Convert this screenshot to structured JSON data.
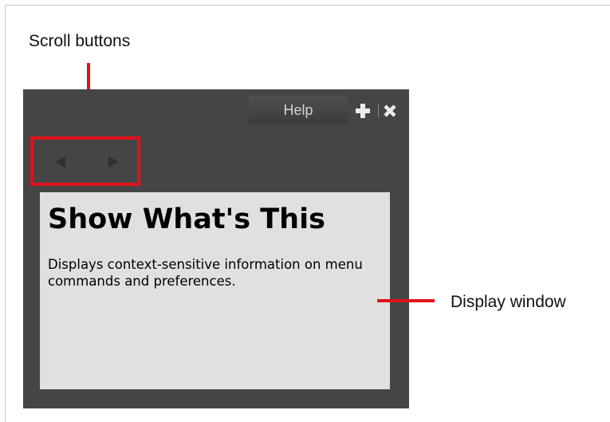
{
  "annotations": {
    "scroll_buttons_label": "Scroll buttons",
    "display_window_label": "Display window",
    "callout_color": "#e0121b"
  },
  "panel": {
    "tab": {
      "label": "Help"
    },
    "tab_controls": {
      "add_icon": "plus-icon",
      "close_icon": "close-icon"
    },
    "scroll_buttons": {
      "back_icon": "triangle-left-icon",
      "forward_icon": "triangle-right-icon"
    },
    "display": {
      "heading": "Show What's This",
      "description": "Displays context-sensitive information on menu commands and preferences."
    },
    "colors": {
      "panel_background": "#454545",
      "display_background": "#e0e0e0"
    }
  }
}
